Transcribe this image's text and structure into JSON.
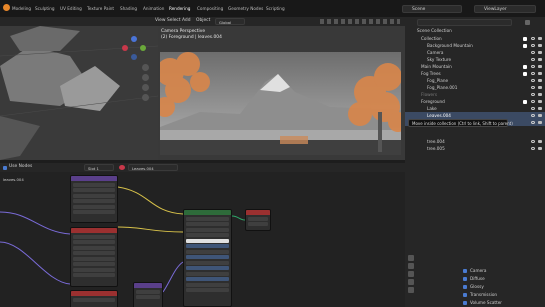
{
  "menu_tabs": [
    "Modeling",
    "Sculpting",
    "UV Editing",
    "Texture Paint",
    "Shading",
    "Animation",
    "Rendering",
    "Compositing",
    "Geometry Nodes",
    "Scripting"
  ],
  "scene_field": "Scene",
  "view_layer_field": "ViewLayer",
  "header3d": {
    "items": [
      "View",
      "Select",
      "Add",
      "Object"
    ],
    "orientation": "Global"
  },
  "camera_view": {
    "title": "Camera Perspective",
    "subtitle": "(2) Foreground | leaves.004"
  },
  "node_header": {
    "use_nodes": "Use Nodes",
    "slot": "Slot 1",
    "material": "Leaves.004"
  },
  "node_editor": {
    "left_label": "leaves.004",
    "node_titles": [
      "Image Texture",
      "Image Texture",
      "Principled BSDF",
      "Material Output",
      "Image Texture",
      "Mapping"
    ]
  },
  "outliner": {
    "rows": [
      {
        "label": "Scene Collection",
        "indent": 0
      },
      {
        "label": "Collection",
        "indent": 1
      },
      {
        "label": "Background Mountain",
        "indent": 2
      },
      {
        "label": "Camera",
        "indent": 2
      },
      {
        "label": "Sky Texture",
        "indent": 2
      },
      {
        "label": "Main Mountain",
        "indent": 1
      },
      {
        "label": "Fog Trees",
        "indent": 1
      },
      {
        "label": "Fog_Plane",
        "indent": 2
      },
      {
        "label": "Fog_Plane.001",
        "indent": 2
      },
      {
        "label": "Flowers",
        "indent": 1
      },
      {
        "label": "Foreground",
        "indent": 1
      },
      {
        "label": "Lake",
        "indent": 2
      },
      {
        "label": "Leaves.004",
        "indent": 2
      },
      {
        "label": "",
        "indent": 2
      },
      {
        "label": "tree.004",
        "indent": 2
      },
      {
        "label": "tree.005",
        "indent": 2
      }
    ],
    "tooltip": "Move inside collection (Ctrl to link, Shift to parent)"
  },
  "properties": {
    "rows": [
      "Camera",
      "Diffuse",
      "Glossy",
      "Transmission",
      "Volume Scatter"
    ]
  },
  "colors": {
    "accent_orange": "#e8872a",
    "selection_blue": "#3b4a63",
    "node_red": "#9b3030",
    "node_green": "#2e6b3a",
    "node_purple": "#5a3f8a",
    "link_yellow": "#d8c24a",
    "link_purple": "#7a6bd8"
  }
}
